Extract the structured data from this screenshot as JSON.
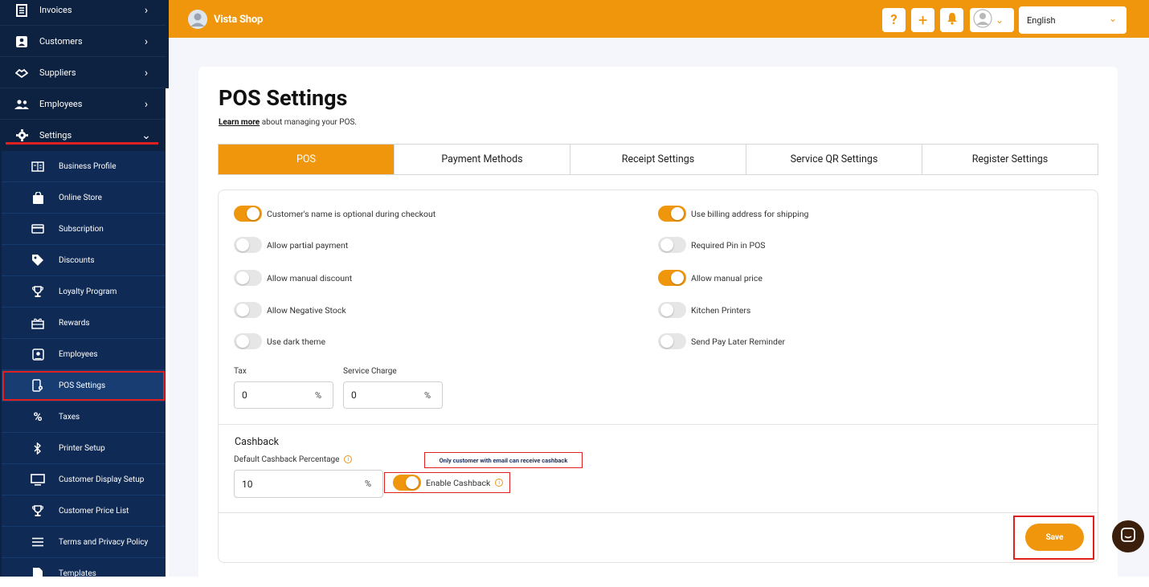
{
  "colors": {
    "accent": "#f0960c",
    "sidebar": "#0d2240",
    "submenu": "#0f2a55",
    "annotation": "#e02020"
  },
  "sidebar": {
    "top_items": [
      {
        "label": "Invoices",
        "icon": "invoice-icon"
      },
      {
        "label": "Customers",
        "icon": "contact-card-icon"
      },
      {
        "label": "Suppliers",
        "icon": "handshake-icon"
      },
      {
        "label": "Employees",
        "icon": "people-icon"
      },
      {
        "label": "Settings",
        "icon": "gear-icon"
      }
    ],
    "settings_items": [
      {
        "label": "Business Profile",
        "icon": "building-icon"
      },
      {
        "label": "Online Store",
        "icon": "shopping-bag-icon"
      },
      {
        "label": "Subscription",
        "icon": "credit-card-icon"
      },
      {
        "label": "Discounts",
        "icon": "tag-icon"
      },
      {
        "label": "Loyalty Program",
        "icon": "trophy-icon"
      },
      {
        "label": "Rewards",
        "icon": "gift-icon"
      },
      {
        "label": "Employees",
        "icon": "employee-badge-icon"
      },
      {
        "label": "POS Settings",
        "icon": "pos-device-icon"
      },
      {
        "label": "Taxes",
        "icon": "percent-icon"
      },
      {
        "label": "Printer Setup",
        "icon": "bluetooth-icon"
      },
      {
        "label": "Customer Display Setup",
        "icon": "monitor-icon"
      },
      {
        "label": "Customer Price List",
        "icon": "trophy-icon"
      },
      {
        "label": "Terms and Privacy Policy",
        "icon": "list-lines-icon"
      },
      {
        "label": "Templates",
        "icon": "template-icon"
      }
    ]
  },
  "header": {
    "brand": "Vista Shop",
    "help_icon": "?",
    "add_icon": "+",
    "language": "English"
  },
  "page": {
    "title": "POS Settings",
    "learn_more": "Learn more",
    "subtitle_rest": "about managing your POS."
  },
  "tabs": [
    "POS",
    "Payment Methods",
    "Receipt Settings",
    "Service QR Settings",
    "Register Settings"
  ],
  "toggles_left": [
    {
      "label": "Customer's name is optional during checkout",
      "on": true
    },
    {
      "label": "Allow partial payment",
      "on": false
    },
    {
      "label": "Allow manual discount",
      "on": false
    },
    {
      "label": "Allow Negative Stock",
      "on": false
    },
    {
      "label": "Use dark theme",
      "on": false
    }
  ],
  "toggles_right": [
    {
      "label": "Use billing address for shipping",
      "on": true
    },
    {
      "label": "Required Pin in POS",
      "on": false
    },
    {
      "label": "Allow manual price",
      "on": true
    },
    {
      "label": "Kitchen Printers",
      "on": false
    },
    {
      "label": "Send Pay Later Reminder",
      "on": false
    }
  ],
  "tax": {
    "label": "Tax",
    "value": "0",
    "suffix": "%"
  },
  "service_charge": {
    "label": "Service Charge",
    "value": "0",
    "suffix": "%"
  },
  "cashback": {
    "title": "Cashback",
    "default_label": "Default Cashback Percentage",
    "default_value": "10",
    "suffix": "%",
    "enable_label": "Enable Cashback",
    "enable_on": true,
    "note": "Only customer with email can receive cashback"
  },
  "save_label": "Save"
}
